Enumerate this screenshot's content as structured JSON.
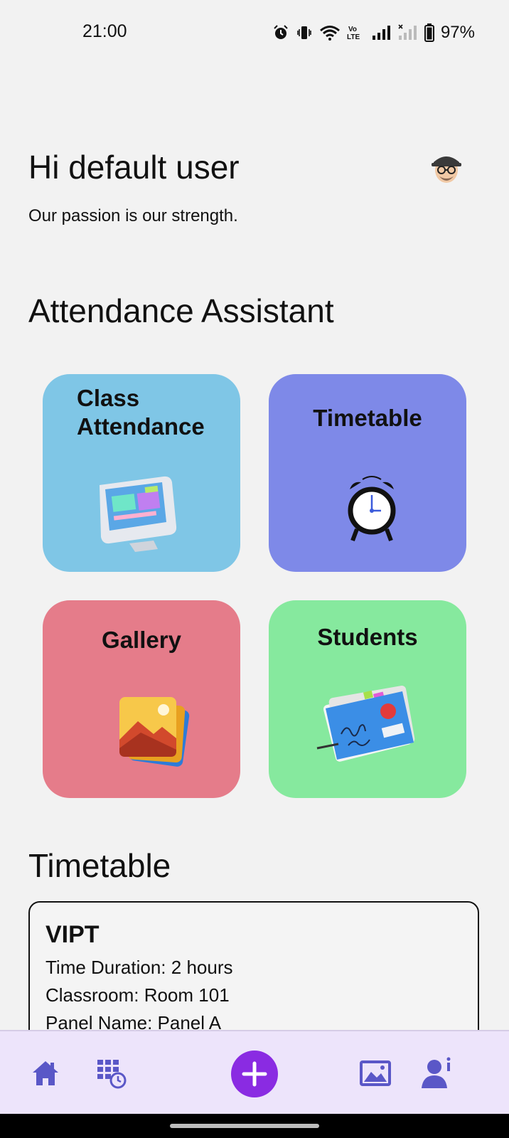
{
  "status_bar": {
    "time": "21:00",
    "battery": "97%",
    "icons": [
      "alarm-icon",
      "vibrate-icon",
      "wifi-icon",
      "volte-icon",
      "signal-icon",
      "signal-empty-icon",
      "battery-icon"
    ]
  },
  "header": {
    "greeting": "Hi default user",
    "tagline": "Our passion is our strength."
  },
  "assistant": {
    "title": "Attendance Assistant",
    "cards": [
      {
        "label": "Class Attendance",
        "icon": "computer-icon",
        "color": "#7fc6e6"
      },
      {
        "label": "Timetable",
        "icon": "alarm-clock-icon",
        "color": "#7e89e8"
      },
      {
        "label": "Gallery",
        "icon": "gallery-icon",
        "color": "#e57c8a"
      },
      {
        "label": "Students",
        "icon": "folder-icon",
        "color": "#86e99e"
      }
    ]
  },
  "timetable": {
    "title": "Timetable",
    "entry": {
      "subject": "VIPT",
      "duration": "Time Duration: 2 hours",
      "classroom": "Classroom: Room 101",
      "panel": "Panel Name: Panel A"
    }
  },
  "bottom_nav": {
    "accent": "#8a2be2",
    "icon_color": "#5a57c7",
    "items": [
      "home-icon",
      "schedule-icon",
      "add-icon",
      "image-icon",
      "profile-info-icon"
    ]
  }
}
